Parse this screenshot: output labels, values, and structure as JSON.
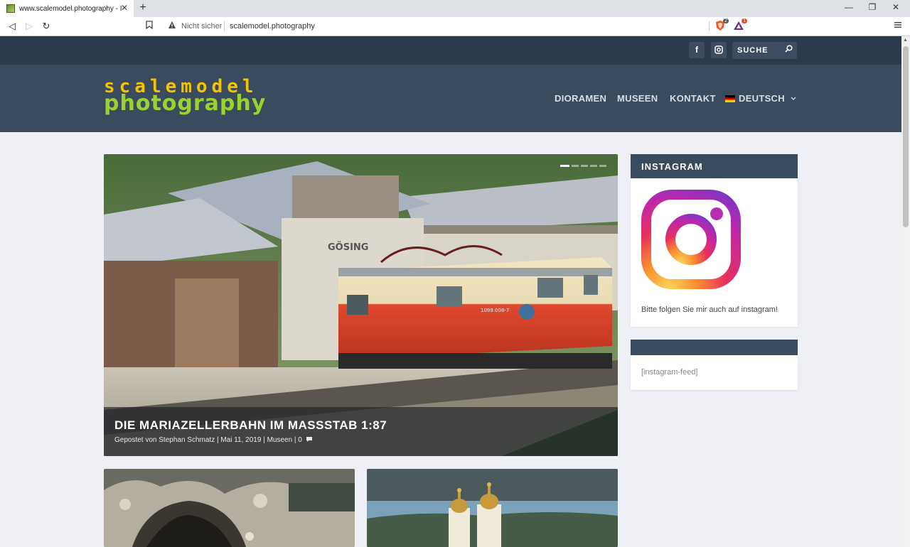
{
  "browser": {
    "tab_title": "www.scalemodel.photography - I",
    "tab_close": "✕",
    "new_tab": "+",
    "minimize": "—",
    "restore": "❐",
    "close": "✕",
    "back": "◁",
    "forward": "▷",
    "reload": "↻",
    "security_label": "Nicht sicher",
    "url": "scalemodel.photography",
    "ext_brave_badge": "2",
    "ext_alert_badge": "1"
  },
  "topbar": {
    "facebook": "f",
    "instagram": "◘",
    "search_label": "SUCHE"
  },
  "header": {
    "logo_top": "scalemodel",
    "logo_bottom": "photography",
    "nav": [
      {
        "label": "DIORAMEN"
      },
      {
        "label": "MUSEEN"
      },
      {
        "label": "KONTAKT"
      },
      {
        "label": "DEUTSCH"
      }
    ]
  },
  "featured": {
    "title": "DIE MARIAZELLERBAHN IM MASSSTAB 1:87",
    "meta": "Gepostet von Stephan Schmatz | Mai 11, 2019 | Museen | 0",
    "station_sign": "GÖSING",
    "loco_number": "1099.008-7",
    "slides_total": 5,
    "slide_active": 1
  },
  "sidebar": {
    "instagram_title": "INSTAGRAM",
    "instagram_text": "Bitte folgen Sie mir auch auf instagram!",
    "feed_title": "",
    "feed_text": "[instagram-feed]"
  },
  "colors": {
    "topbar": "#2c3a4b",
    "header": "#3b4b5e",
    "logo_yellow": "#f5c400",
    "logo_green": "#9bd32e",
    "page_bg": "#eef0f5"
  }
}
